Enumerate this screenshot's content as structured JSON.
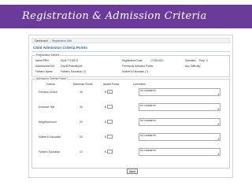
{
  "slide": {
    "title": "Registration & Admission Criteria"
  },
  "breadcrumb": {
    "home": "Dashboard",
    "current": "Registration Allot"
  },
  "page": {
    "title": "Child Admission Criteria Points"
  },
  "registration": {
    "legend": "Registration Details",
    "rows": [
      [
        {
          "label": "Name/PRN:",
          "value": "Sunil  7715/572"
        },
        {
          "label": "Registration Date:",
          "value": "17/03/2013"
        },
        {
          "label": "Standard:",
          "value": "Prep. 3"
        }
      ],
      [
        {
          "label": "Address/and BH:",
          "value": "City/B-Prashat/phil"
        },
        {
          "label": "Previously Selected Points:",
          "value": ""
        },
        {
          "label": "Any Difficulty:",
          "value": ""
        }
      ],
      [
        {
          "label": "Father's Name:",
          "value": "Father's Education (?)"
        },
        {
          "label": "Mother's Education (?)",
          "value": ""
        },
        {
          "label": "",
          "value": ""
        }
      ]
    ]
  },
  "criteria": {
    "legend": "Admission Criteria Points",
    "headers": {
      "criteria": "Criteria",
      "max_points": "Maximum Points",
      "alloted_points": "Alloted Points",
      "comments": "Comments"
    },
    "rows": [
      {
        "criteria": "Previous School",
        "max_points": "30",
        "currency": "$",
        "alloted": "7",
        "comment": "NO COMMENTS"
      },
      {
        "criteria": "Entrance Test",
        "max_points": "30",
        "currency": "$",
        "alloted": "",
        "comment": "NO COMMENTS"
      },
      {
        "criteria": "Neighbourhood",
        "max_points": "20",
        "currency": "$",
        "alloted": "",
        "comment": "NO COMMENTS"
      },
      {
        "criteria": "Mother's Education",
        "max_points": "20",
        "currency": "$",
        "alloted": "",
        "comment": "NO COMMENTS"
      },
      {
        "criteria": "Father's Education",
        "max_points": "10",
        "currency": "$",
        "alloted": "",
        "comment": "NO COMMENTS"
      }
    ]
  },
  "actions": {
    "save_label": "Save"
  },
  "colors": {
    "slide_title_bg": "#6a3b9a",
    "page_title": "#2d6aa8"
  },
  "icons": {
    "resize_grip": "resize-grip-icon"
  }
}
